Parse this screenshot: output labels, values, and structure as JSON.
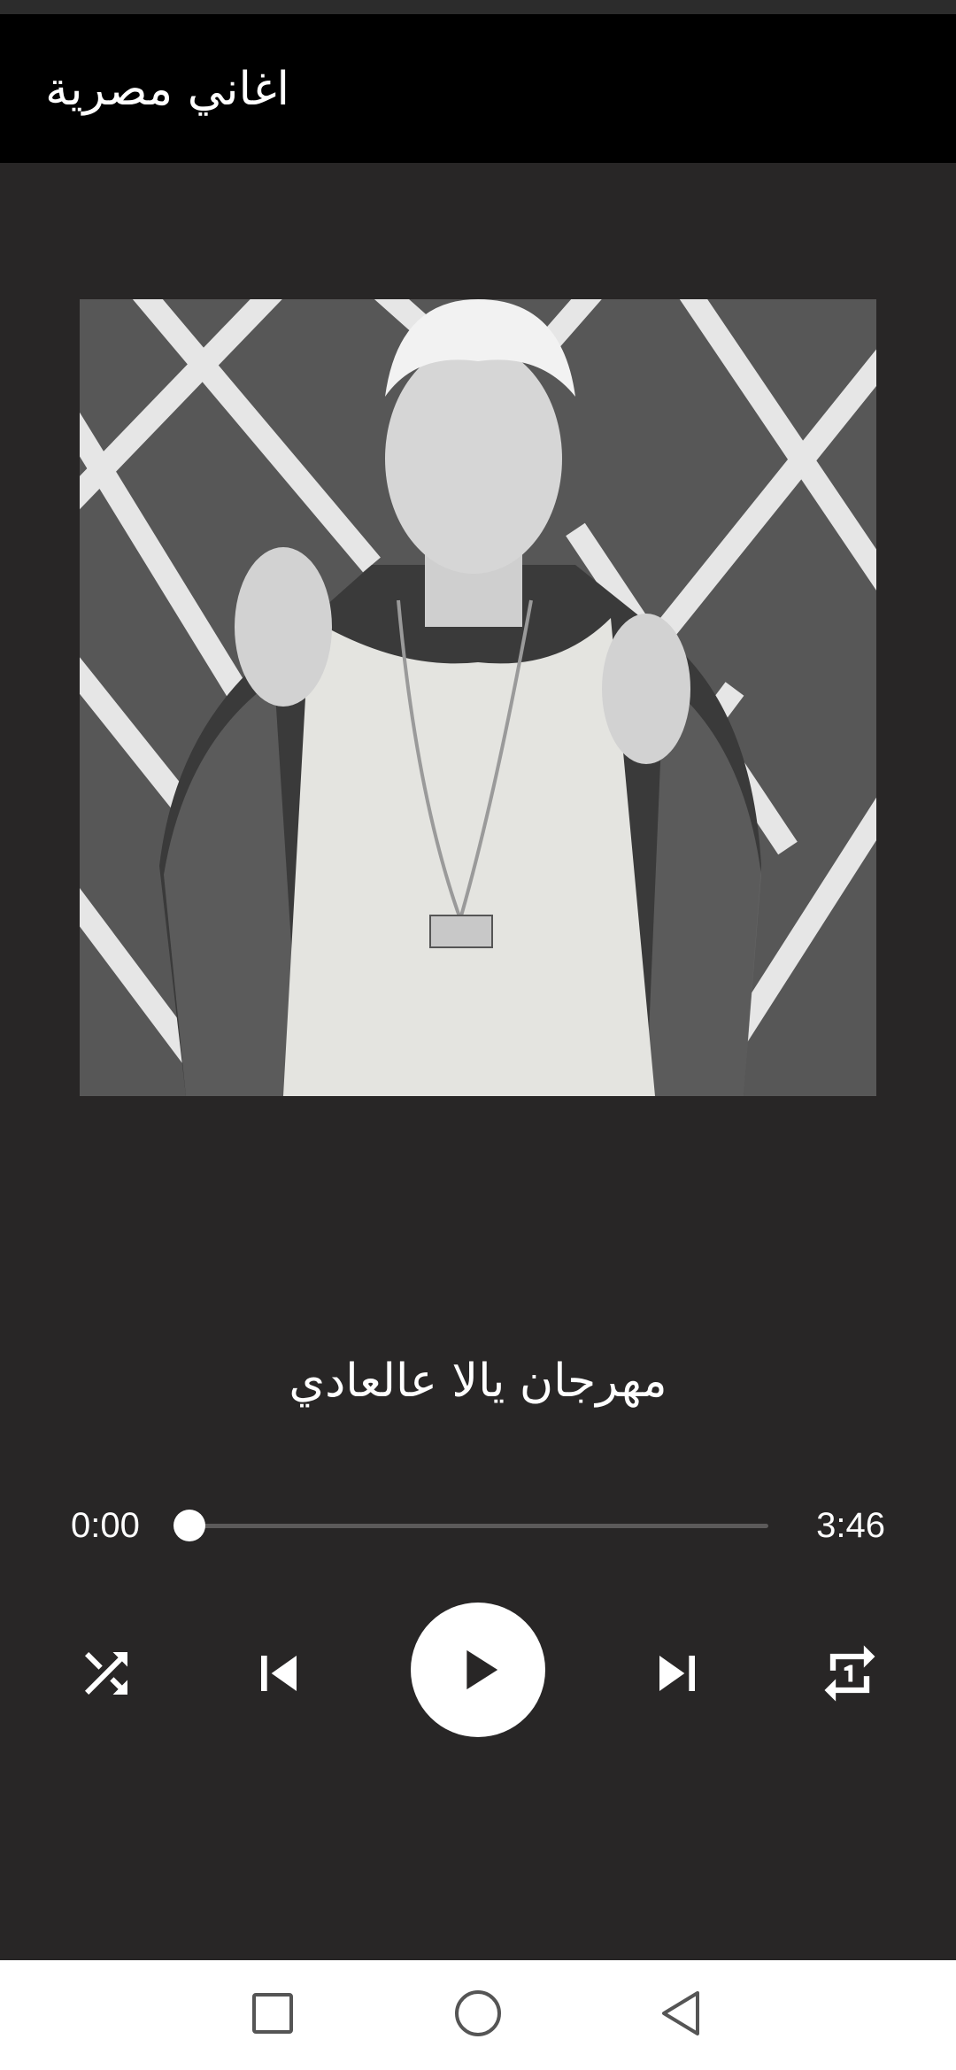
{
  "app": {
    "title": "اغاني مصرية"
  },
  "player": {
    "song_title": "مهرجان يالا عالعادي",
    "current_time": "0:00",
    "total_time": "3:46",
    "progress": 0.0,
    "state": "paused"
  },
  "controls": {
    "shuffle_icon": "shuffle-icon",
    "previous_icon": "skip-previous-icon",
    "play_icon": "play-icon",
    "next_icon": "skip-next-icon",
    "repeat_icon": "repeat-one-icon"
  },
  "navigation": {
    "recents_icon": "square-icon",
    "home_icon": "circle-icon",
    "back_icon": "triangle-back-icon"
  },
  "colors": {
    "background": "#282626",
    "app_bar": "#000000",
    "accent": "#ffffff",
    "nav_bar": "#ffffff"
  }
}
